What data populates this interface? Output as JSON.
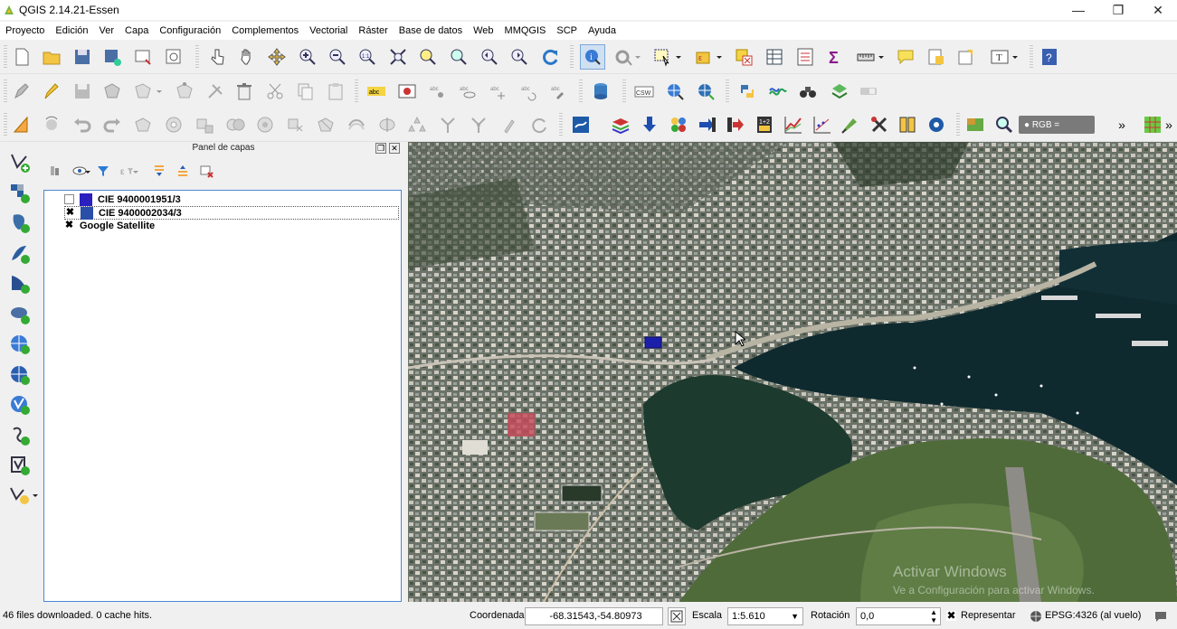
{
  "window": {
    "title": "QGIS 2.14.21-Essen",
    "controls": {
      "minimize": "—",
      "restore": "❐",
      "close": "✕"
    }
  },
  "menubar": {
    "items": [
      "Proyecto",
      "Edición",
      "Ver",
      "Capa",
      "Configuración",
      "Complementos",
      "Vectorial",
      "Ráster",
      "Base de datos",
      "Web",
      "MMQGIS",
      "SCP",
      "Ayuda"
    ]
  },
  "toolbar3": {
    "rgb_label": "● RGB =",
    "overflow": "»"
  },
  "layers_panel": {
    "title": "Panel de capas",
    "layers": [
      {
        "name": "CIE 9400001951/3",
        "checked": "",
        "color": "#2a1fbf"
      },
      {
        "name": "CIE 9400002034/3",
        "checked": "✖",
        "color": "#2a4fa8"
      },
      {
        "name": "Google Satellite",
        "checked": "✖"
      }
    ]
  },
  "statusbar": {
    "message": "46 files downloaded. 0 cache hits.",
    "coord_label": "Coordenada",
    "coord_value": "-68.31543,-54.80973",
    "scale_label": "Escala",
    "scale_value": "1:5.610",
    "rotation_label": "Rotación",
    "rotation_value": "0,0",
    "render_label": "Representar",
    "render_checked": "✖",
    "crs_label": "EPSG:4326 (al vuelo)"
  },
  "watermark": {
    "line1": "Activar Windows",
    "line2": "Ve a Configuración para activar Windows."
  }
}
